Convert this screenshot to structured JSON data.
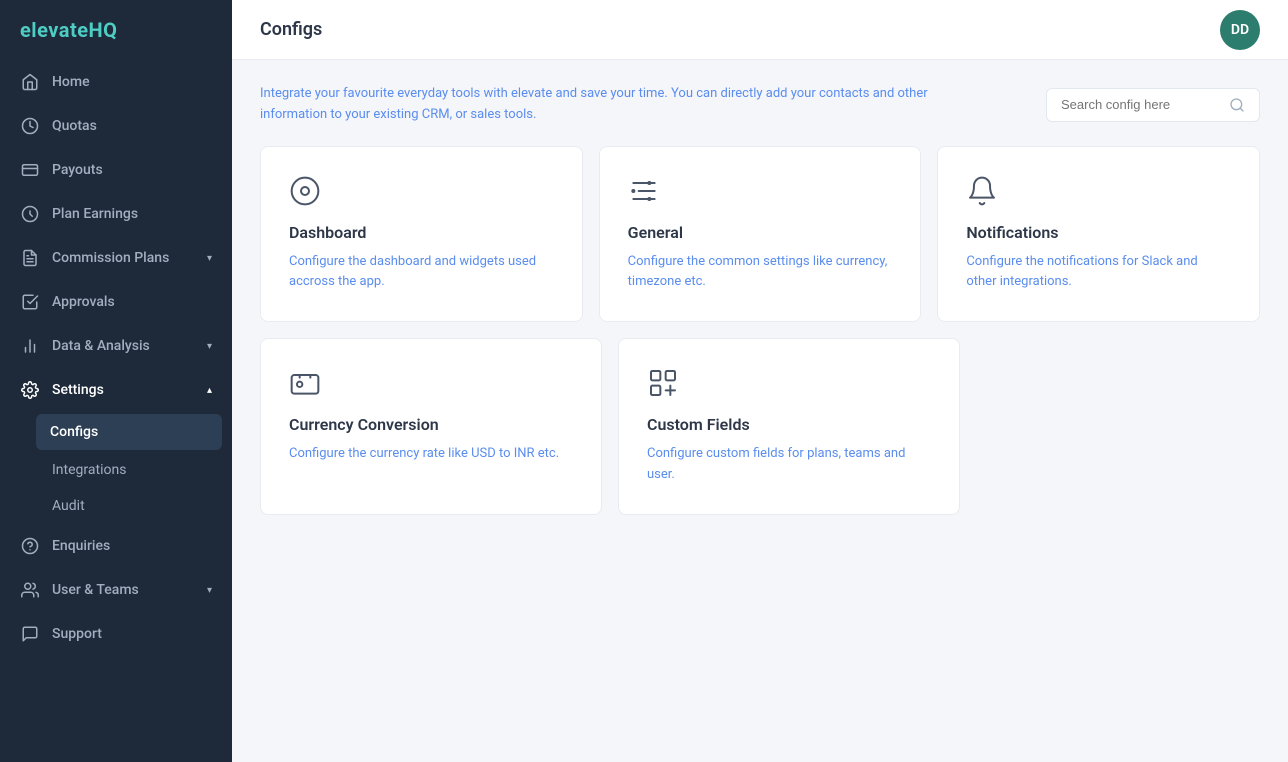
{
  "logo": {
    "text_white": "elevate",
    "text_accent": "HQ"
  },
  "sidebar": {
    "items": [
      {
        "id": "home",
        "label": "Home",
        "icon": "home-icon",
        "active": false,
        "has_sub": false
      },
      {
        "id": "quotas",
        "label": "Quotas",
        "icon": "quotas-icon",
        "active": false,
        "has_sub": false
      },
      {
        "id": "payouts",
        "label": "Payouts",
        "icon": "payouts-icon",
        "active": false,
        "has_sub": false
      },
      {
        "id": "plan-earnings",
        "label": "Plan Earnings",
        "icon": "plan-earnings-icon",
        "active": false,
        "has_sub": false
      },
      {
        "id": "commission-plans",
        "label": "Commission Plans",
        "icon": "commission-icon",
        "active": false,
        "has_sub": true
      },
      {
        "id": "approvals",
        "label": "Approvals",
        "icon": "approvals-icon",
        "active": false,
        "has_sub": false
      },
      {
        "id": "data-analysis",
        "label": "Data & Analysis",
        "icon": "data-icon",
        "active": false,
        "has_sub": true
      },
      {
        "id": "settings",
        "label": "Settings",
        "icon": "settings-icon",
        "active": true,
        "has_sub": true
      }
    ],
    "sub_items": [
      {
        "id": "configs",
        "label": "Configs",
        "active": true
      },
      {
        "id": "integrations",
        "label": "Integrations",
        "active": false
      },
      {
        "id": "audit",
        "label": "Audit",
        "active": false
      }
    ],
    "bottom_items": [
      {
        "id": "enquiries",
        "label": "Enquiries",
        "icon": "enquiries-icon"
      },
      {
        "id": "user-teams",
        "label": "User & Teams",
        "icon": "user-teams-icon",
        "has_sub": true
      },
      {
        "id": "support",
        "label": "Support",
        "icon": "support-icon"
      }
    ]
  },
  "header": {
    "title": "Configs",
    "avatar_initials": "DD"
  },
  "info_banner": {
    "text": "Integrate your favourite everyday tools with elevate and save your time. You can directly add your contacts and other information to your existing CRM, or sales tools."
  },
  "search": {
    "placeholder": "Search config here"
  },
  "cards": [
    {
      "id": "dashboard",
      "title": "Dashboard",
      "description": "Configure the dashboard and widgets used accross the app."
    },
    {
      "id": "general",
      "title": "General",
      "description": "Configure the common settings like currency, timezone etc."
    },
    {
      "id": "notifications",
      "title": "Notifications",
      "description": "Configure the notifications for Slack and other integrations."
    },
    {
      "id": "currency-conversion",
      "title": "Currency Conversion",
      "description": "Configure the currency rate like USD to INR etc."
    },
    {
      "id": "custom-fields",
      "title": "Custom Fields",
      "description": "Configure custom fields for plans, teams and user."
    }
  ],
  "colors": {
    "accent": "#4ecdc4",
    "sidebar_bg": "#1e2a3a",
    "link_blue": "#5a8dee",
    "active_sub": "#2d3f55",
    "avatar_bg": "#2d7d6e"
  }
}
